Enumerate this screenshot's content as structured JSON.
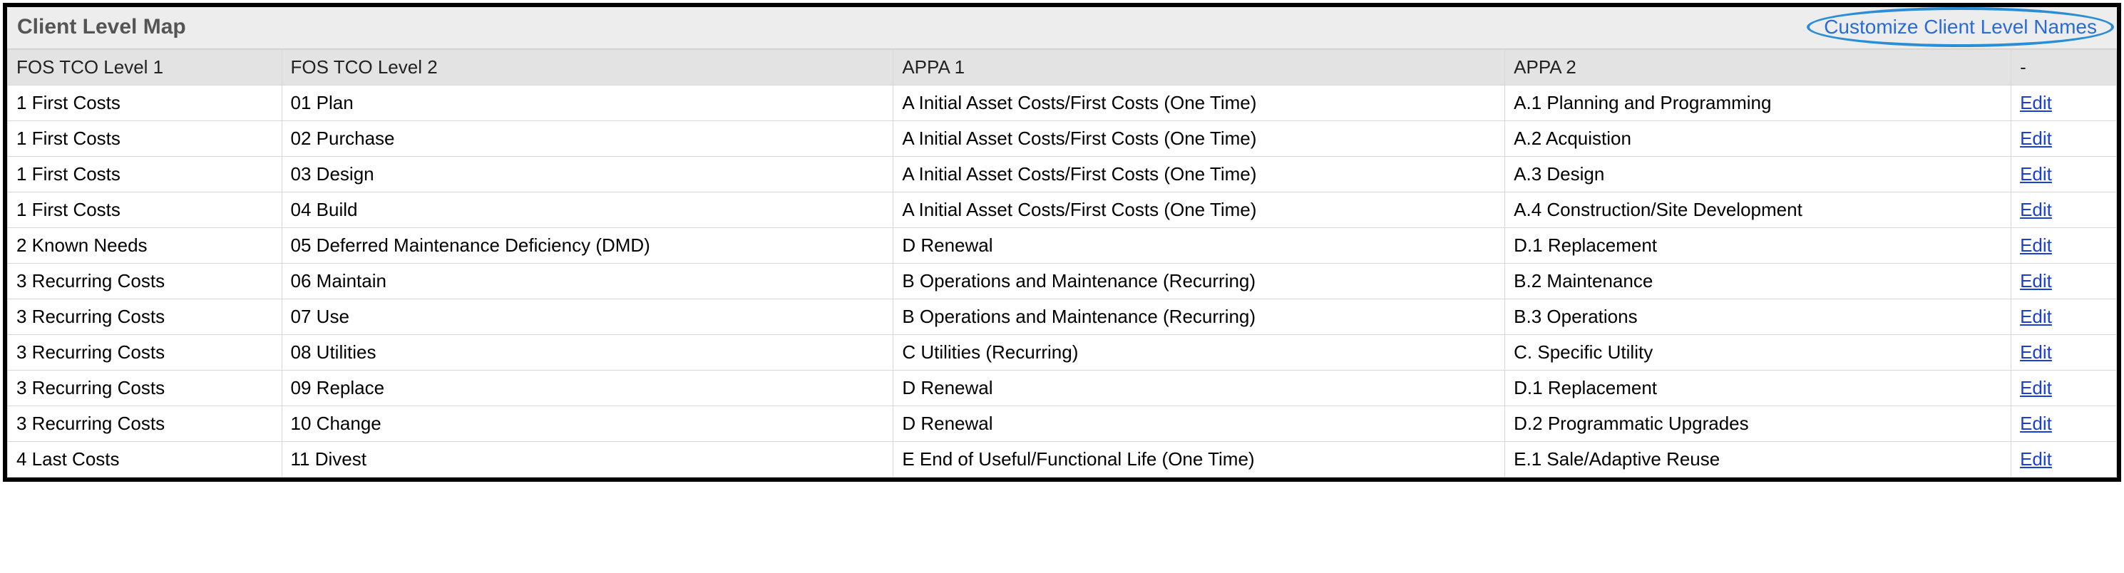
{
  "header": {
    "title": "Client Level Map",
    "customize_label": "Customize Client Level Names"
  },
  "table": {
    "columns": [
      "FOS TCO Level 1",
      "FOS TCO Level 2",
      "APPA 1",
      "APPA 2",
      "-"
    ],
    "edit_label": "Edit",
    "rows": [
      {
        "c1": "1 First Costs",
        "c2": "01 Plan",
        "c3": "A Initial Asset Costs/First Costs (One Time)",
        "c4": "A.1 Planning and Programming"
      },
      {
        "c1": "1 First Costs",
        "c2": "02 Purchase",
        "c3": "A Initial Asset Costs/First Costs (One Time)",
        "c4": "A.2 Acquistion"
      },
      {
        "c1": "1 First Costs",
        "c2": "03 Design",
        "c3": "A Initial Asset Costs/First Costs (One Time)",
        "c4": "A.3 Design"
      },
      {
        "c1": "1 First Costs",
        "c2": "04 Build",
        "c3": "A Initial Asset Costs/First Costs (One Time)",
        "c4": "A.4 Construction/Site Development"
      },
      {
        "c1": "2 Known Needs",
        "c2": "05 Deferred Maintenance Deficiency (DMD)",
        "c3": "D Renewal",
        "c4": "D.1 Replacement"
      },
      {
        "c1": "3 Recurring Costs",
        "c2": "06 Maintain",
        "c3": "B Operations and Maintenance (Recurring)",
        "c4": "B.2 Maintenance"
      },
      {
        "c1": "3 Recurring Costs",
        "c2": "07 Use",
        "c3": "B Operations and Maintenance (Recurring)",
        "c4": "B.3 Operations"
      },
      {
        "c1": "3 Recurring Costs",
        "c2": "08 Utilities",
        "c3": "C Utilities (Recurring)",
        "c4": "C. Specific Utility"
      },
      {
        "c1": "3 Recurring Costs",
        "c2": "09 Replace",
        "c3": "D Renewal",
        "c4": "D.1 Replacement"
      },
      {
        "c1": "3 Recurring Costs",
        "c2": "10 Change",
        "c3": "D Renewal",
        "c4": "D.2 Programmatic Upgrades"
      },
      {
        "c1": "4 Last Costs",
        "c2": "11 Divest",
        "c3": "E End of Useful/Functional Life (One Time)",
        "c4": "E.1 Sale/Adaptive Reuse"
      }
    ]
  }
}
